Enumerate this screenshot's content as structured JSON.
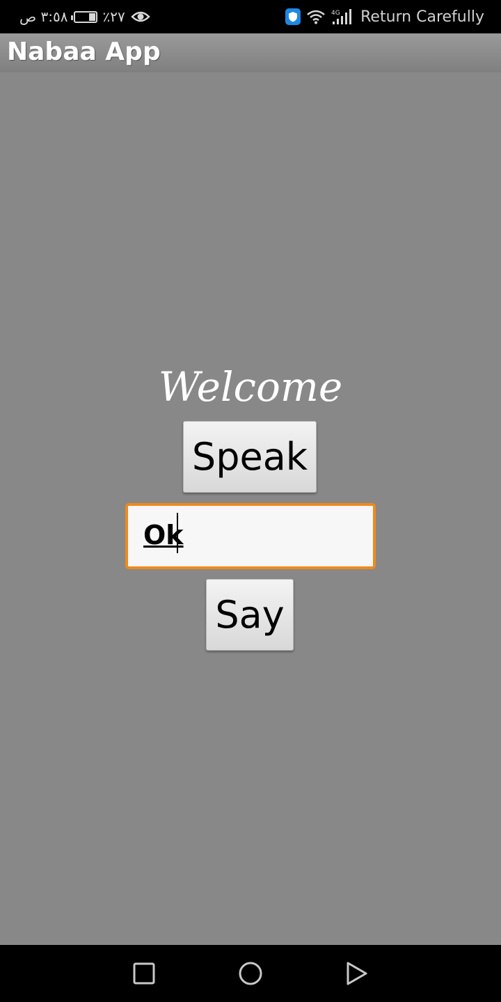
{
  "status_bar": {
    "time": "٣:٥٨ ص",
    "battery_percent": "٪٢٧",
    "carrier": "Return Carefully",
    "network": "4G",
    "icons": [
      "eye-icon",
      "battery-icon",
      "shield-icon",
      "wifi-icon",
      "signal-icon"
    ]
  },
  "app": {
    "title": "Nabaa App"
  },
  "main": {
    "welcome_label": "Welcome",
    "speak_button": "Speak",
    "text_input_value": "Ok",
    "say_button": "Say"
  },
  "nav_bar": {
    "icons": [
      "recent-apps-icon",
      "home-icon",
      "back-icon"
    ]
  },
  "colors": {
    "background": "#888888",
    "input_focus_border": "#ee8a1c",
    "status_bar": "#000000"
  }
}
